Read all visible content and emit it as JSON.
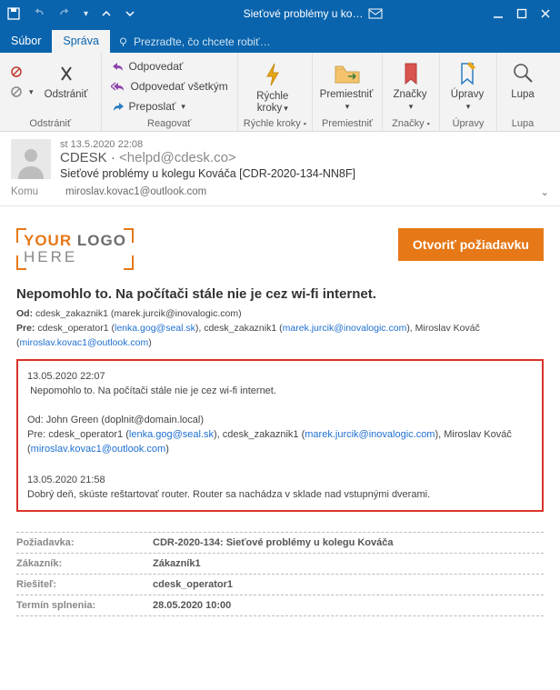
{
  "titlebar": {
    "title": "Sieťové problémy u ko…"
  },
  "tabs": {
    "file": "Súbor",
    "message": "Správa",
    "tell_me": "Prezraďte, čo chcete robiť…"
  },
  "ribbon": {
    "delete_group": "Odstrániť",
    "delete": "Odstrániť",
    "respond_group": "Reagovať",
    "reply": "Odpovedať",
    "reply_all": "Odpovedať všetkým",
    "forward": "Preposlať",
    "quick_group": "Rýchle kroky",
    "quick": "Rýchle\nkroky",
    "move_group": "Premiestniť",
    "move": "Premiestniť",
    "tags_group": "Značky",
    "tags": "Značky",
    "editing_group": "Úpravy",
    "editing": "Úpravy",
    "zoom_group": "Lupa",
    "zoom": "Lupa"
  },
  "header": {
    "date": "st 13.5.2020 22:08",
    "from_name": "CDESK",
    "from_email": "<helpd@cdesk.co>",
    "subject": "Sieťové problémy u kolegu Kováča [CDR-2020-134-NN8F]",
    "to_label": "Komu",
    "to_value": "miroslav.kovac1@outlook.com"
  },
  "body": {
    "logo1a": "YOUR",
    "logo1b": "LOGO",
    "logo2": "HERE",
    "open_btn": "Otvoriť požiadavku",
    "headline": "Nepomohlo to. Na počítači stále nie je cez wi-fi internet.",
    "od_label": "Od:",
    "pre_label": "Pre:",
    "od_val": "cdesk_zakaznik1 (marek.jurcik@inovalogic.com)",
    "pre_1a": "cdesk_operator1 (",
    "pre_1a_mail": "lenka.gog@seal.sk",
    "pre_1b": "), cdesk_zakaznik1 (",
    "pre_1b_mail": "marek.jurcik@inovalogic.com",
    "pre_1c": "), Miroslav Kováč (",
    "pre_1c_mail": "miroslav.kovac1@outlook.com",
    "pre_1d": ")",
    "t1_ts": "13.05.2020 22:07",
    "t1_body": "Nepomohlo to. Na počítači stále nie je cez wi-fi internet.",
    "t2_od": "Od: John Green (doplnit@domain.local)",
    "t2_pre_a": "Pre: cdesk_operator1 (",
    "t2_pre_a_mail": "lenka.gog@seal.sk",
    "t2_pre_b": "), cdesk_zakaznik1 (",
    "t2_pre_b_mail": "marek.jurcik@inovalogic.com",
    "t2_pre_c": "), Miroslav Kováč (",
    "t2_pre_c_mail": "miroslav.kovac1@outlook.com",
    "t2_pre_d": ")",
    "t3_ts": "13.05.2020 21:58",
    "t3_body": "Dobrý deň, skúste reštartovať router. Router sa nachádza v sklade nad vstupnými dverami."
  },
  "table": {
    "rows": [
      {
        "k": "Požiadavka:",
        "v": "CDR-2020-134: Sieťové problémy u kolegu Kováča"
      },
      {
        "k": "Zákazník:",
        "v": "Zákazník1"
      },
      {
        "k": "Riešiteľ:",
        "v": "cdesk_operator1"
      },
      {
        "k": "Termín splnenia:",
        "v": "28.05.2020 10:00"
      }
    ]
  }
}
